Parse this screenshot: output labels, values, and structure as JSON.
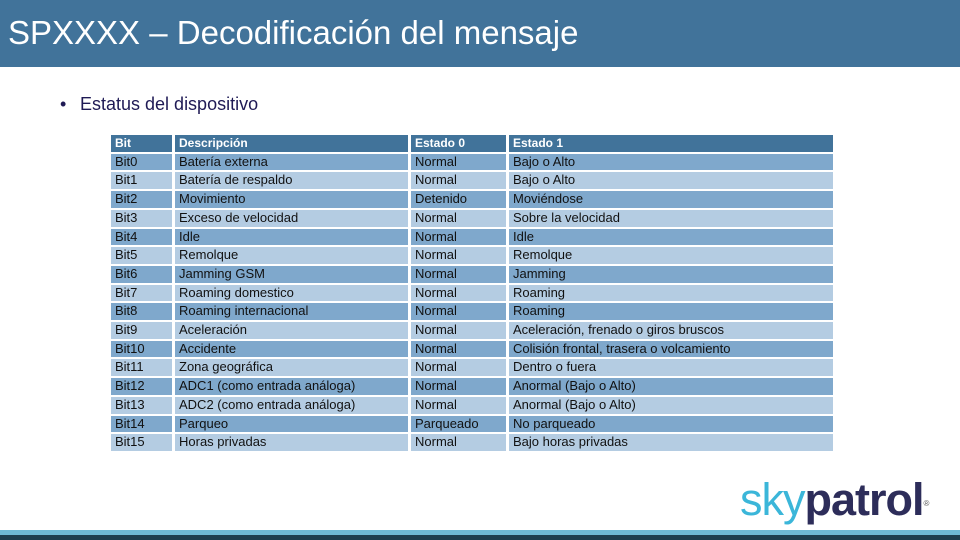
{
  "header": {
    "title": "SPXXXX – Decodificación del mensaje"
  },
  "content": {
    "bullet_symbol": "•",
    "bullet_text": "Estatus del dispositivo"
  },
  "table": {
    "columns": [
      "Bit",
      "Descripción",
      "Estado 0",
      "Estado 1"
    ],
    "rows": [
      [
        "Bit0",
        "Batería externa",
        "Normal",
        "Bajo o Alto"
      ],
      [
        "Bit1",
        "Batería de respaldo",
        "Normal",
        "Bajo o Alto"
      ],
      [
        "Bit2",
        "Movimiento",
        "Detenido",
        "Moviéndose"
      ],
      [
        "Bit3",
        "Exceso de velocidad",
        "Normal",
        "Sobre la velocidad"
      ],
      [
        "Bit4",
        "Idle",
        "Normal",
        "Idle"
      ],
      [
        "Bit5",
        "Remolque",
        "Normal",
        "Remolque"
      ],
      [
        "Bit6",
        "Jamming GSM",
        "Normal",
        "Jamming"
      ],
      [
        "Bit7",
        "Roaming domestico",
        "Normal",
        "Roaming"
      ],
      [
        "Bit8",
        "Roaming internacional",
        "Normal",
        "Roaming"
      ],
      [
        "Bit9",
        "Aceleración",
        "Normal",
        "Aceleración, frenado o giros bruscos"
      ],
      [
        "Bit10",
        "Accidente",
        "Normal",
        "Colisión frontal, trasera o volcamiento"
      ],
      [
        "Bit11",
        "Zona geográfica",
        "Normal",
        "Dentro o fuera"
      ],
      [
        "Bit12",
        "ADC1 (como entrada análoga)",
        "Normal",
        "Anormal (Bajo o Alto)"
      ],
      [
        "Bit13",
        "ADC2 (como entrada análoga)",
        "Normal",
        "Anormal (Bajo o Alto)"
      ],
      [
        "Bit14",
        "Parqueo",
        "Parqueado",
        "No parqueado"
      ],
      [
        "Bit15",
        "Horas privadas",
        "Normal",
        "Bajo horas privadas"
      ]
    ]
  },
  "logo": {
    "part1": "sky",
    "part2": "patrol",
    "mark": "®"
  },
  "colors": {
    "header_bg": "#41739a",
    "row_dark": "#7fa8cc",
    "row_light": "#b4cce2",
    "logo_sky": "#3bb6d9",
    "logo_patrol": "#2d2d5a"
  }
}
